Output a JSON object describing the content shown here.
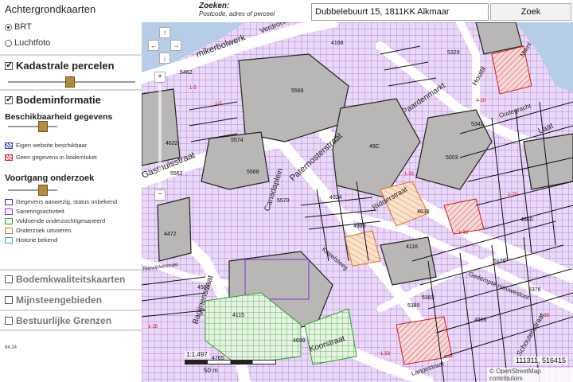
{
  "sidebar": {
    "background_title": "Achtergrondkaarten",
    "background_options": [
      {
        "label": "BRT",
        "selected": true
      },
      {
        "label": "Luchtfoto",
        "selected": false
      }
    ],
    "kadastrale_label": "Kadastrale percelen",
    "kadastrale_checked": true,
    "bodeminfo_label": "Bodeminformatie",
    "bodeminfo_checked": true,
    "beschikbaarheid_title": "Beschikbaarheid gegevens",
    "beschikbaarheid_legend": [
      {
        "label": "Eigen website beschikbaar",
        "color": "#3030c0"
      },
      {
        "label": "Geen gegevens in bodemloket",
        "color": "#d02020"
      }
    ],
    "voortgang_title": "Voortgang onderzoek",
    "voortgang_legend": [
      {
        "label": "Gegevens aanwezig, status onbekend",
        "color": "#3030c0"
      },
      {
        "label": "Saneringsactiviteit",
        "color": "#8a2be2"
      },
      {
        "label": "Voldoende onderzocht/gesaneerd",
        "color": "#2ea02e"
      },
      {
        "label": "Onderzoek uitvoeren",
        "color": "#e07020"
      },
      {
        "label": "Historie bekend",
        "color": "#20b0c0"
      }
    ],
    "extra_layers": [
      {
        "label": "Bodemkwaliteitskaarten",
        "checked": false
      },
      {
        "label": "Mijnsteengebieden",
        "checked": false
      },
      {
        "label": "Bestuurlijke Grenzen",
        "checked": false
      }
    ],
    "version": "84.24"
  },
  "search": {
    "label": "Zoeken:",
    "hint": "Postcode, adres of perceel",
    "value": "Dubbelebuurt 15, 1811KK Alkmaar",
    "button": "Zoek"
  },
  "map": {
    "streets": {
      "verdronkenoord": "Verdronkenoord",
      "mient": "mikerbolwerk",
      "canadaplein": "Canadaplein",
      "paternosterstraat": "Paternosterstraat",
      "gasthuisstraat": "Gasthuisstraat",
      "bagijnenstraat": "Bagijnenstraat",
      "kapelsteeg": "Kapelsteeg",
      "koorstraat": "Koorstraat",
      "langestraat": "Langestraat",
      "gedempte": "Gedempte nieuwesloot",
      "ridderstraat": "Ridderstraat",
      "laat": "Laat",
      "houttil": "Houttil",
      "waagplein": "Paardenmarkt",
      "rietwijk": "Rietwijckerstraat",
      "schoutenstraat": "Schoutenstraat",
      "mient2": "Mient",
      "gracht": "Oudegracht"
    },
    "parcel_numbers": [
      "5462",
      "5566",
      "4168",
      "5329",
      "5574",
      "5568",
      "5570",
      "4632",
      "5562",
      "4472",
      "49C",
      "4624",
      "4638",
      "5003",
      "5341",
      "5120",
      "4115",
      "4905",
      "4765",
      "5389",
      "4699",
      "4999",
      "4116",
      "5383",
      "4606",
      "4660",
      "5376"
    ],
    "red_labels": [
      "1-5",
      "1-15",
      "1-33",
      "1-48",
      "4-10",
      "1-5",
      "1-70",
      "1-53",
      "1-39"
    ],
    "scale_ratio": "1:1.497",
    "scale_text": "50 m",
    "coordinates": "111311, 516415",
    "attribution": "© OpenStreetMap contributors",
    "colors": {
      "parcel_fill": "#e4d4f4",
      "parcel_hatch": "#9d5fd6",
      "building": "#b9b6b6",
      "road": "#ffffff",
      "water": "#b5cde6",
      "green_hatch": "#2ea02e",
      "orange_hatch": "#e07020"
    }
  },
  "controls": {
    "pan_up": "↑",
    "pan_left": "←",
    "pan_right": "→",
    "pan_down": "↓",
    "zoom_in": "+",
    "zoom_out": "−"
  }
}
